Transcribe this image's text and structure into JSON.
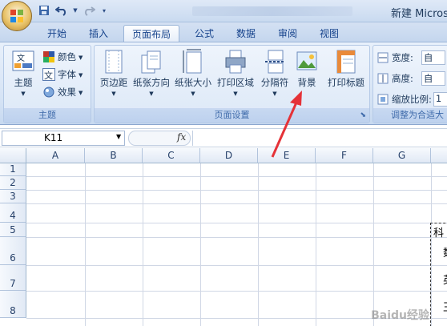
{
  "window": {
    "title": "新建 Microso"
  },
  "quick_access": {
    "icons": [
      "save-icon",
      "undo-icon",
      "redo-icon",
      "customize-icon"
    ]
  },
  "tabs": [
    {
      "label": "开始"
    },
    {
      "label": "插入"
    },
    {
      "label": "页面布局",
      "active": true
    },
    {
      "label": "公式"
    },
    {
      "label": "数据"
    },
    {
      "label": "审阅"
    },
    {
      "label": "视图"
    }
  ],
  "ribbon": {
    "theme_group": {
      "label": "主题",
      "theme_button": "主题",
      "colors": "颜色",
      "fonts": "字体",
      "effects": "效果"
    },
    "page_setup_group": {
      "label": "页面设置",
      "margins": "页边距",
      "orientation": "纸张方向",
      "size": "纸张大小",
      "print_area": "打印区域",
      "breaks": "分隔符",
      "background": "背景",
      "print_titles": "打印标题"
    },
    "scale_group": {
      "label": "调整为合适大",
      "width_label": "宽度:",
      "width_value": "自",
      "height_label": "高度:",
      "height_value": "自",
      "scale_label": "缩放比例:",
      "scale_value": "1"
    }
  },
  "formula_bar": {
    "name_box": "K11",
    "fx": "fx",
    "formula": ""
  },
  "sheet": {
    "columns": [
      "A",
      "B",
      "C",
      "D",
      "E",
      "F",
      "G"
    ],
    "rows": [
      "1",
      "2",
      "3",
      "4",
      "5",
      "6",
      "7",
      "8"
    ],
    "cells": {
      "h5": "科",
      "h6": "数",
      "h7": "英",
      "h8": "王"
    }
  },
  "watermark": "Baidu经验",
  "colors": {
    "accent_arrow": "#e53238",
    "ribbon_blue": "#15428b"
  }
}
